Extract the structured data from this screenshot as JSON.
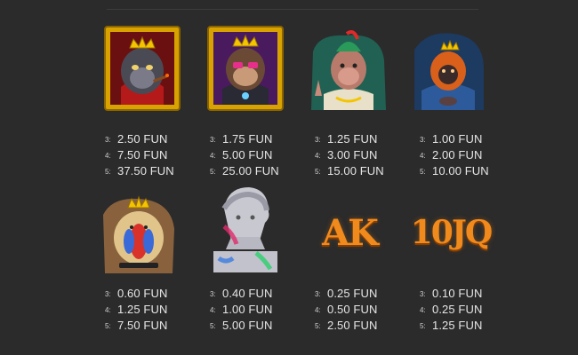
{
  "currency": "FUN",
  "symbols": [
    {
      "name": "gorilla-king",
      "icon": "gorilla-king-icon",
      "pays": [
        {
          "n": "3:",
          "v": "2.50 FUN"
        },
        {
          "n": "4:",
          "v": "7.50 FUN"
        },
        {
          "n": "5:",
          "v": "37.50 FUN"
        }
      ]
    },
    {
      "name": "monkey-king",
      "icon": "monkey-crown-icon",
      "pays": [
        {
          "n": "3:",
          "v": "1.75 FUN"
        },
        {
          "n": "4:",
          "v": "5.00 FUN"
        },
        {
          "n": "5:",
          "v": "25.00 FUN"
        }
      ]
    },
    {
      "name": "punk-monkey",
      "icon": "punk-monkey-icon",
      "pays": [
        {
          "n": "3:",
          "v": "1.25 FUN"
        },
        {
          "n": "4:",
          "v": "3.00 FUN"
        },
        {
          "n": "5:",
          "v": "15.00 FUN"
        }
      ]
    },
    {
      "name": "orangutan",
      "icon": "orangutan-icon",
      "pays": [
        {
          "n": "3:",
          "v": "1.00 FUN"
        },
        {
          "n": "4:",
          "v": "2.00 FUN"
        },
        {
          "n": "5:",
          "v": "10.00 FUN"
        }
      ]
    },
    {
      "name": "mandrill",
      "icon": "mandrill-icon",
      "pays": [
        {
          "n": "3:",
          "v": "0.60 FUN"
        },
        {
          "n": "4:",
          "v": "1.25 FUN"
        },
        {
          "n": "5:",
          "v": "7.50 FUN"
        }
      ]
    },
    {
      "name": "statue-head",
      "icon": "statue-head-icon",
      "pays": [
        {
          "n": "3:",
          "v": "0.40 FUN"
        },
        {
          "n": "4:",
          "v": "1.00 FUN"
        },
        {
          "n": "5:",
          "v": "5.00 FUN"
        }
      ]
    },
    {
      "name": "ace-king",
      "letters": "AK",
      "pays": [
        {
          "n": "3:",
          "v": "0.25 FUN"
        },
        {
          "n": "4:",
          "v": "0.50 FUN"
        },
        {
          "n": "5:",
          "v": "2.50 FUN"
        }
      ]
    },
    {
      "name": "ten-jack-queen",
      "letters": "10JQ",
      "pays": [
        {
          "n": "3:",
          "v": "0.10 FUN"
        },
        {
          "n": "4:",
          "v": "0.25 FUN"
        },
        {
          "n": "5:",
          "v": "1.25 FUN"
        }
      ]
    }
  ],
  "colors": {
    "background": "#2b2b2b",
    "text": "#e6e6e6",
    "gold": "#e8b400",
    "orange": "#f08a1c"
  }
}
